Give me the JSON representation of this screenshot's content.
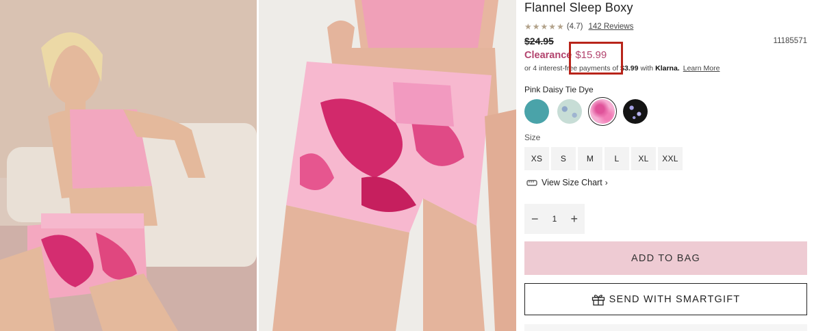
{
  "product": {
    "title": "Flannel Sleep Boxy",
    "rating_value": "(4.7)",
    "reviews_label": "142 Reviews",
    "original_price": "$24.95",
    "item_number": "11185571",
    "clearance_label": "Clearance",
    "clearance_price": "$15.99"
  },
  "klarna": {
    "prefix": "or 4 interest-free payments of",
    "amount": "$3.99",
    "with": "with",
    "brand": "Klarna.",
    "learn_more": "Learn More"
  },
  "color": {
    "selected_name": "Pink Daisy Tie Dye",
    "swatches": [
      {
        "name": "teal",
        "color": "#4aa3a9"
      },
      {
        "name": "mint-print",
        "color": "#c7ddd6"
      },
      {
        "name": "pink-tie-dye",
        "color": "#ee8fc4"
      },
      {
        "name": "black-butterfly",
        "color": "#141414"
      }
    ]
  },
  "size": {
    "label": "Size",
    "options": [
      "XS",
      "S",
      "M",
      "L",
      "XL",
      "XXL"
    ],
    "chart_link": "View Size Chart"
  },
  "quantity": {
    "minus": "−",
    "value": "1",
    "plus": "+"
  },
  "actions": {
    "add_to_bag": "ADD TO BAG",
    "smartgift": "SEND WITH SMARTGIFT"
  },
  "colors": {
    "accent_clearance": "#b2436d",
    "add_bag_bg": "#eecbd3",
    "highlight_box": "#b8241a"
  }
}
